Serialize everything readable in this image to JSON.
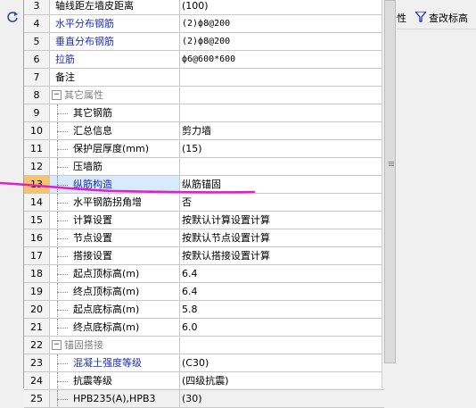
{
  "toolbar_right": {
    "partial_text": "性",
    "query_label": "查改标高"
  },
  "rows": [
    {
      "num": "3",
      "name": "轴线距左墙皮距离",
      "value": "(100)",
      "level": 0,
      "name_color": "black"
    },
    {
      "num": "4",
      "name": "水平分布钢筋",
      "value": "(2)ф8@200",
      "level": 0,
      "name_color": "blue"
    },
    {
      "num": "5",
      "name": "垂直分布钢筋",
      "value": "(2)ф8@200",
      "level": 0,
      "name_color": "blue"
    },
    {
      "num": "6",
      "name": "拉筋",
      "value": "ф6@600*600",
      "level": 0,
      "name_color": "blue"
    },
    {
      "num": "7",
      "name": "备注",
      "value": "",
      "level": 0,
      "name_color": "black"
    },
    {
      "num": "8",
      "name": "其它属性",
      "value": "",
      "level": "group",
      "name_color": "gray",
      "expander": "−"
    },
    {
      "num": "9",
      "name": "其它钢筋",
      "value": "",
      "level": 1,
      "name_color": "black"
    },
    {
      "num": "10",
      "name": "汇总信息",
      "value": "剪力墙",
      "level": 1,
      "name_color": "black"
    },
    {
      "num": "11",
      "name": "保护层厚度(mm)",
      "value": "(15)",
      "level": 1,
      "name_color": "black"
    },
    {
      "num": "12",
      "name": "压墙筋",
      "value": "",
      "level": 1,
      "name_color": "black"
    },
    {
      "num": "13",
      "name": "纵筋构造",
      "value": "纵筋锚固",
      "level": 1,
      "name_color": "blue",
      "selected": true
    },
    {
      "num": "14",
      "name": "水平钢筋拐角增",
      "value": "否",
      "level": 1,
      "name_color": "black"
    },
    {
      "num": "15",
      "name": "计算设置",
      "value": "按默认计算设置计算",
      "level": 1,
      "name_color": "black"
    },
    {
      "num": "16",
      "name": "节点设置",
      "value": "按默认节点设置计算",
      "level": 1,
      "name_color": "black"
    },
    {
      "num": "17",
      "name": "搭接设置",
      "value": "按默认搭接设置计算",
      "level": 1,
      "name_color": "black"
    },
    {
      "num": "18",
      "name": "起点顶标高(m)",
      "value": "6.4",
      "level": 1,
      "name_color": "black"
    },
    {
      "num": "19",
      "name": "终点顶标高(m)",
      "value": "6.4",
      "level": 1,
      "name_color": "black"
    },
    {
      "num": "20",
      "name": "起点底标高(m)",
      "value": "5.8",
      "level": 1,
      "name_color": "black"
    },
    {
      "num": "21",
      "name": "终点底标高(m)",
      "value": "6.0",
      "level": 1,
      "name_color": "black"
    },
    {
      "num": "22",
      "name": "锚固搭接",
      "value": "",
      "level": "group",
      "name_color": "gray",
      "expander": "−"
    },
    {
      "num": "23",
      "name": "混凝土强度等级",
      "value": "(C30)",
      "level": 1,
      "name_color": "blue"
    },
    {
      "num": "24",
      "name": "抗震等级",
      "value": "(四级抗震)",
      "level": 1,
      "name_color": "black"
    },
    {
      "num": "25",
      "name": "HPB235(A),HPB3",
      "value": "(30)",
      "level": 1,
      "name_color": "black"
    }
  ],
  "colors": {
    "accent_blue": "#1d2fb8",
    "annotation": "#e020c8",
    "selected_num_bg": "#f7c46a"
  },
  "icons": {
    "left_toolbar": "refresh-icon",
    "query": "funnel-icon"
  }
}
